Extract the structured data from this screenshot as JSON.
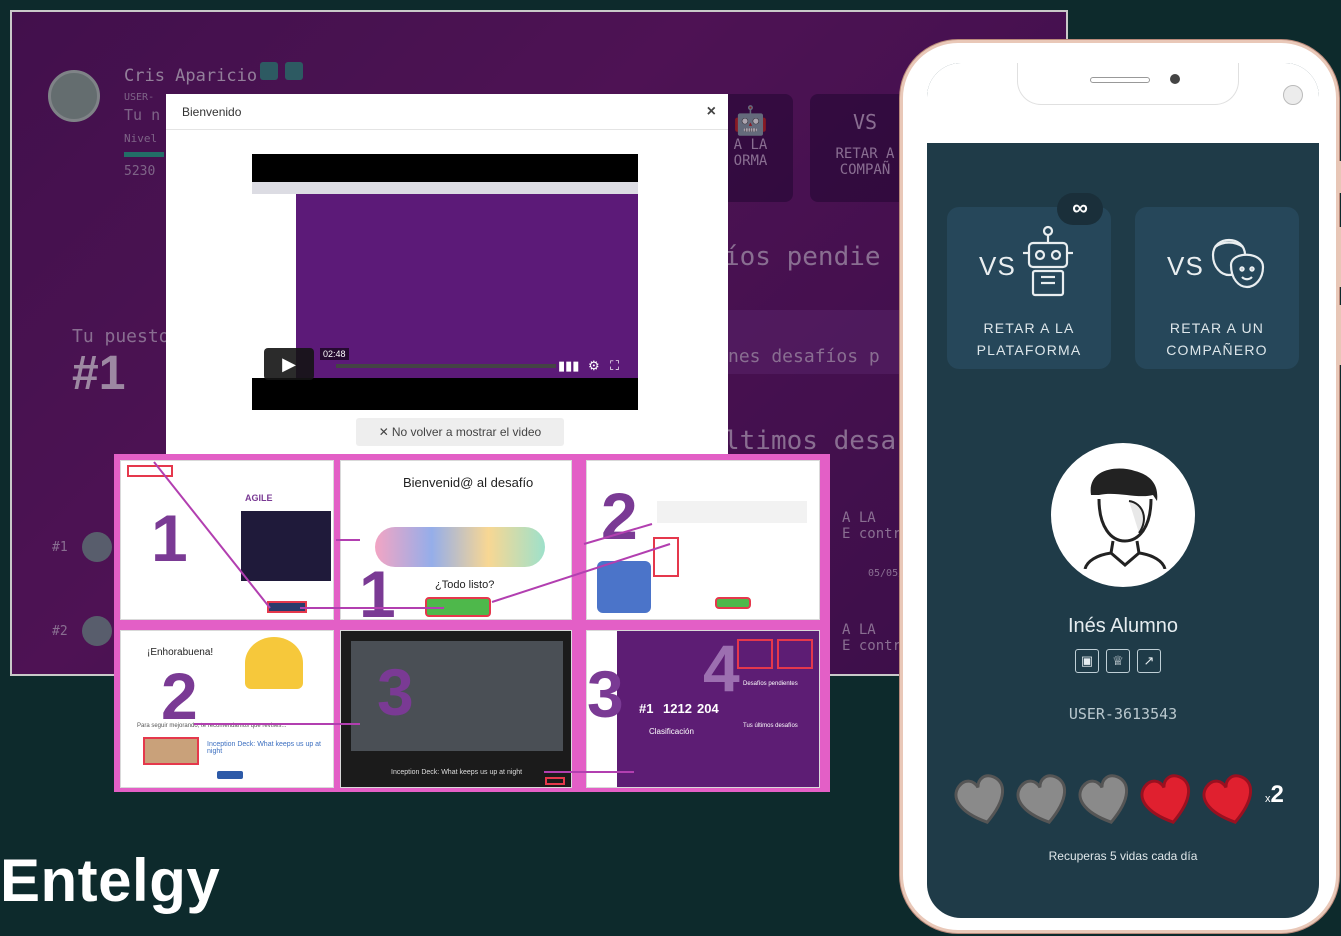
{
  "desktop": {
    "user_name": "Cris Aparicio",
    "user_id_partial": "USER-",
    "tu_nivel_partial": "Tu n",
    "nivel_partial": "Nivel",
    "points": "5230",
    "puesto_label": "Tu puesto",
    "rank": "#1",
    "list": [
      "#1",
      "#2"
    ],
    "card1": [
      "A LA",
      "ORMA"
    ],
    "card2": [
      "RETAR A",
      "COMPAÑ"
    ],
    "pendientes_partial": "íos pendie",
    "desafios_partial": "nes desafíos p",
    "ultimos_partial": "ltimos desa",
    "row1": [
      "A LA",
      "E contr"
    ],
    "row2": [
      "A LA",
      "E contr"
    ],
    "date_partial": "05/05/"
  },
  "modal": {
    "title": "Bienvenido",
    "close": "×",
    "video_time": "02:48",
    "no_volver": "No volver a mostrar el video"
  },
  "collage": {
    "step1": "1",
    "step1b": "1",
    "step2": "2",
    "step2b": "2",
    "step3": "3",
    "step3b": "3",
    "step4": "4",
    "welcome": "Bienvenid@ al desafío",
    "todo_listo": "¿Todo listo?",
    "enhorabuena": "¡Enhorabuena!",
    "seguir": "Para seguir mejorando, te recomendamos que revises...",
    "inception1": "Inception Deck: What keeps us up at night",
    "inception2": "Inception Deck: What keeps us up at night",
    "stats": [
      "#1",
      "1212",
      "204"
    ],
    "clasificacion": "Clasificación",
    "pendientes": "Desafíos pendientes",
    "ultimos": "Tus últimos desafíos",
    "agile_logo": "AGILE"
  },
  "phone": {
    "vs": "VS",
    "infinity": "∞",
    "challenge1": [
      "RETAR A LA",
      "PLATAFORMA"
    ],
    "challenge2": [
      "RETAR A UN",
      "COMPAÑERO"
    ],
    "name": "Inés Alumno",
    "user_id": "USER-3613543",
    "lives_prefix": "x",
    "lives_count": "2",
    "recover_text": "Recuperas 5 vidas cada día",
    "icons": [
      "badge-icon",
      "trophy-icon",
      "chart-icon"
    ]
  },
  "brand": {
    "logo": "Entelgy"
  },
  "colors": {
    "background": "#0d2a2c",
    "desktop_purple": "#6d1d72",
    "collage_border": "#e35fc6",
    "phone_screen": "#1f3b48",
    "heart_red": "#e0202f",
    "heart_grey": "#8a8a8a"
  }
}
